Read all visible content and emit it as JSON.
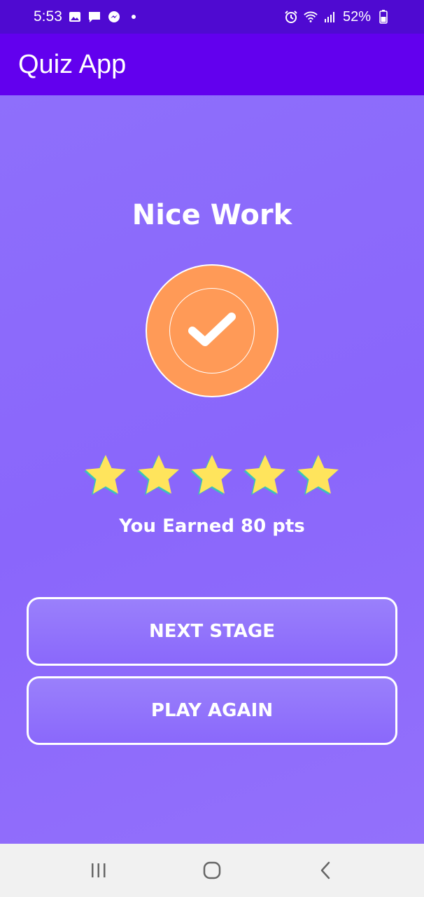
{
  "status_bar": {
    "time": "5:53",
    "battery": "52%",
    "left_icons": [
      "gallery-icon",
      "message-icon",
      "messenger-icon",
      "dot-icon"
    ],
    "right_icons": [
      "alarm-icon",
      "wifi-icon",
      "signal-icon",
      "battery-icon"
    ]
  },
  "app_bar": {
    "title": "Quiz App"
  },
  "result": {
    "title": "Nice Work",
    "badge_icon": "check-icon",
    "stars": 5,
    "earned_text": "You Earned 80 pts"
  },
  "buttons": {
    "next_stage": "NEXT STAGE",
    "play_again": "PLAY AGAIN"
  },
  "nav_bar": {
    "items": [
      "recent-apps-icon",
      "home-icon",
      "back-icon"
    ]
  },
  "colors": {
    "status_bar": "#4f0ad1",
    "app_bar": "#6200ee",
    "background": "#8d6bfb",
    "badge": "#ff9a57",
    "star": "#ffe45c",
    "star_edge": "#3cc3b8"
  }
}
